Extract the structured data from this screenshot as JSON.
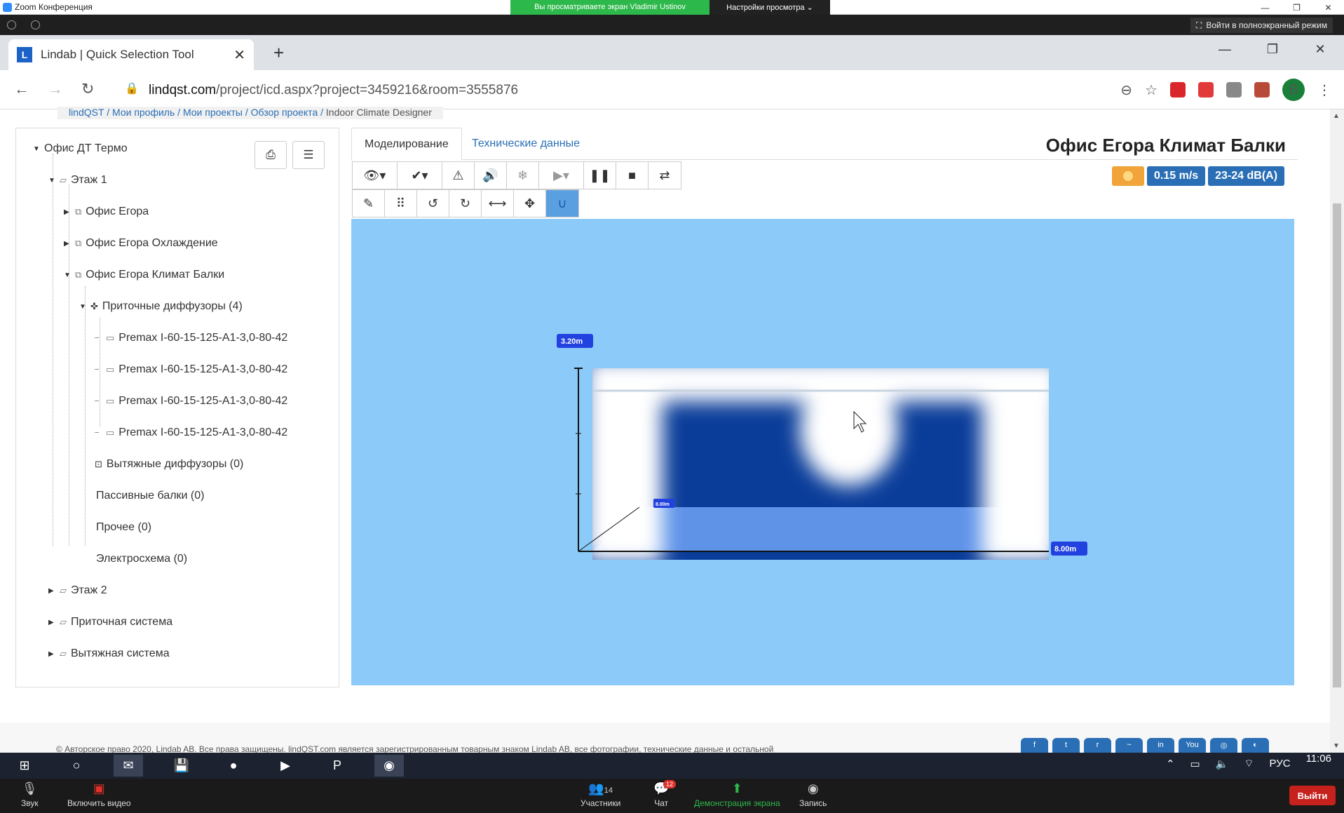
{
  "zoom": {
    "window_title": "Zoom Конференция",
    "share_banner": "Вы просматриваете экран Vladimir Ustinov",
    "view_settings": "Настройки просмотра ⌄",
    "fullscreen": "Войти в полноэкранный режим",
    "controls": {
      "audio": "Звук",
      "video": "Включить видео",
      "participants": "Участники",
      "participants_count": "14",
      "chat": "Чат",
      "chat_badge": "12",
      "share": "Демонстрация экрана",
      "record": "Запись",
      "leave": "Выйти"
    }
  },
  "browser": {
    "tab_title": "Lindab | Quick Selection Tool",
    "tab_favicon": "L",
    "url_host": "lindqst.com",
    "url_path": "/project/icd.aspx?project=3459216&room=3555876",
    "profile_initial": "В"
  },
  "breadcrumb": {
    "items": [
      "lindQST",
      "Мои профиль",
      "Мои проекты",
      "Обзор проекта"
    ],
    "current": "Indoor Climate Designer"
  },
  "tree": {
    "root": "Офис ДТ Термо",
    "nodes": [
      "Этаж 1",
      "Офис Егора",
      "Офис Егора Охлаждение",
      "Офис Егора Климат Балки",
      "Приточные диффузоры (4)",
      "Premax I-60-15-125-A1-3,0-80-42",
      "Premax I-60-15-125-A1-3,0-80-42",
      "Premax I-60-15-125-A1-3,0-80-42",
      "Premax I-60-15-125-A1-3,0-80-42",
      "Вытяжные диффузоры (0)",
      "Пассивные балки (0)",
      "Прочее (0)",
      "Электросхема (0)",
      "Этаж 2",
      "Приточная система",
      "Вытяжная система"
    ]
  },
  "main": {
    "tab_model": "Моделирование",
    "tab_tech": "Технические данные",
    "room_title": "Офис Егора Климат Балки",
    "speed": "0.15 m/s",
    "noise": "23-24 dB(A)"
  },
  "viewport": {
    "height_label": "3.20m",
    "depth_label": "8.00m",
    "width_label": "8.00m",
    "colors": {
      "background": "#8ccbf9",
      "wall": "#0a3d9a",
      "floor": "#5f93e8",
      "label": "#2242e0"
    }
  },
  "footer": {
    "copyright": "© Авторское право 2020, Lindab AB. Все права защищены. lindQST.com является зарегистрированным товарным знаком Lindab AB, все фотографии, технические данные и остальной"
  },
  "taskbar": {
    "language": "РУС",
    "time": "11:06"
  }
}
